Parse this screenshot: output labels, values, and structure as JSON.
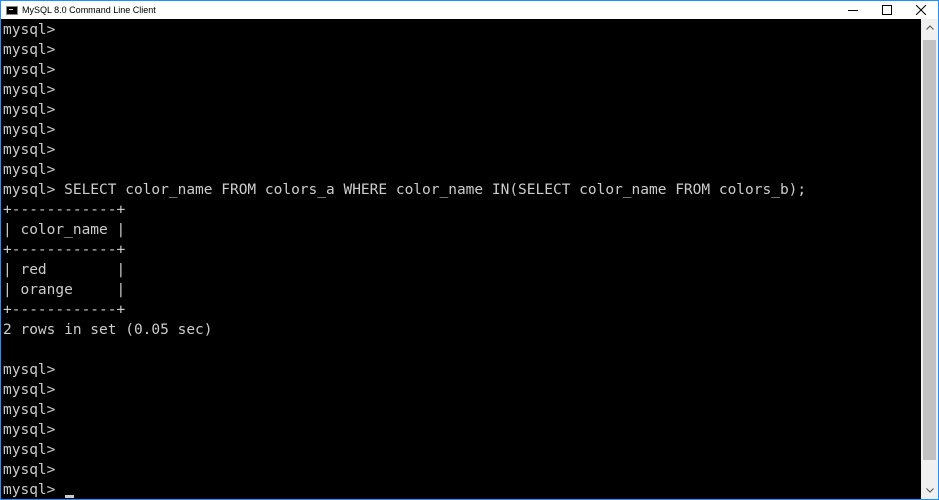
{
  "window": {
    "title": "MySQL 8.0 Command Line Client"
  },
  "console": {
    "lines": [
      "mysql>",
      "mysql>",
      "mysql>",
      "mysql>",
      "mysql>",
      "mysql>",
      "mysql>",
      "mysql>",
      "mysql> SELECT color_name FROM colors_a WHERE color_name IN(SELECT color_name FROM colors_b);",
      "+------------+",
      "| color_name |",
      "+------------+",
      "| red        |",
      "| orange     |",
      "+------------+",
      "2 rows in set (0.05 sec)",
      "",
      "mysql>",
      "mysql>",
      "mysql>",
      "mysql>",
      "mysql>",
      "mysql>",
      "mysql> "
    ]
  },
  "colors": {
    "console_bg": "#000000",
    "console_text": "#cccccc",
    "window_border": "#1e90ff"
  }
}
